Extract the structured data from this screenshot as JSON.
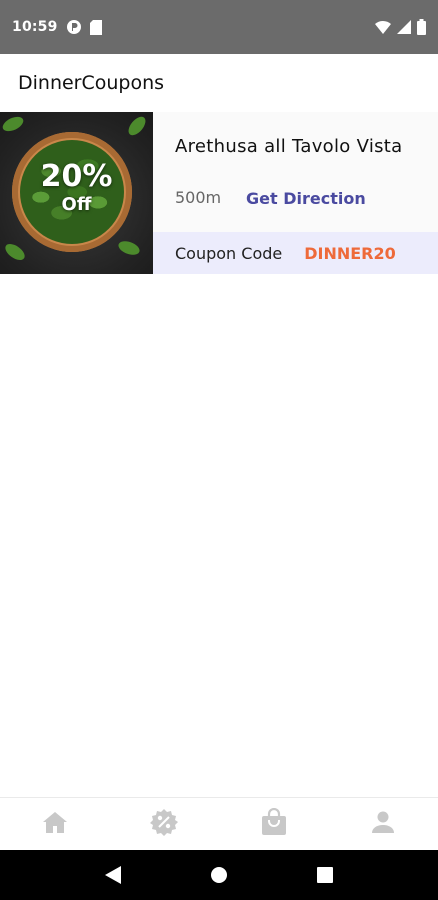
{
  "status_bar": {
    "time": "10:59",
    "icons": [
      "media-icon",
      "sd-card-icon",
      "wifi-icon",
      "signal-icon",
      "battery-icon"
    ]
  },
  "app_bar": {
    "title": "DinnerCoupons"
  },
  "coupons": [
    {
      "discount_percent": "20%",
      "discount_suffix": "Off",
      "restaurant_name": "Arethusa all Tavolo Vista",
      "distance": "500m",
      "direction_label": "Get Direction",
      "coupon_label": "Coupon Code",
      "coupon_code": "DINNER20"
    }
  ],
  "bottom_nav": {
    "items": [
      "home-icon",
      "discount-icon",
      "shopping-bag-icon",
      "profile-icon"
    ]
  },
  "system_nav": [
    "back-icon",
    "home-circle-icon",
    "recents-icon"
  ],
  "colors": {
    "status_bar_bg": "#6b6b6b",
    "direction_link": "#4a4aa0",
    "coupon_code": "#ee6a3a",
    "coupon_strip_bg": "#ececfc",
    "nav_icon": "#c8c8c8"
  }
}
